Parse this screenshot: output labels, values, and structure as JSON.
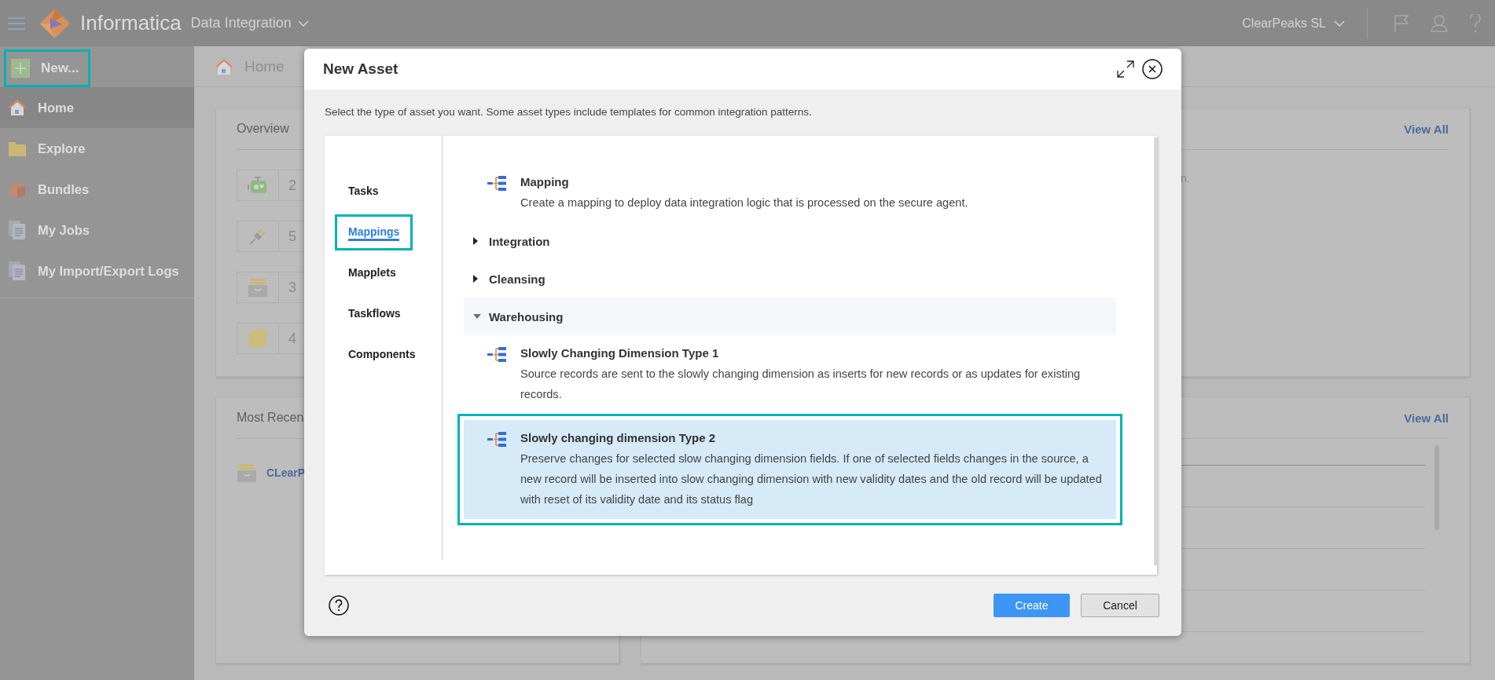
{
  "header": {
    "brand": "Informatica",
    "product": "Data Integration",
    "organization": "ClearPeaks SL"
  },
  "sidebar": {
    "new_button": {
      "label": "New...",
      "highlighted": true
    },
    "items": [
      {
        "label": "Home",
        "selected": true
      },
      {
        "label": "Explore",
        "selected": false
      },
      {
        "label": "Bundles",
        "selected": false
      },
      {
        "label": "My Jobs",
        "selected": false
      },
      {
        "label": "My Import/Export Logs",
        "selected": false
      }
    ]
  },
  "breadcrumb": "Home",
  "overview_card": {
    "title": "Overview",
    "counts": [
      "2",
      "5",
      "3",
      "4"
    ]
  },
  "activity_card": {
    "link": "View All",
    "text_fragment": "n."
  },
  "recent_card": {
    "title": "Most Recen",
    "items": [
      "CLearP"
    ]
  },
  "jobs_card": {
    "link": "View All"
  },
  "dialog": {
    "title": "New Asset",
    "instruction": "Select the type of asset you want. Some asset types include templates for common integration patterns.",
    "categories": [
      {
        "label": "Tasks",
        "selected": false,
        "highlighted": false
      },
      {
        "label": "Mappings",
        "selected": true,
        "highlighted": true
      },
      {
        "label": "Mapplets",
        "selected": false,
        "highlighted": false
      },
      {
        "label": "Taskflows",
        "selected": false,
        "highlighted": false
      },
      {
        "label": "Components",
        "selected": false,
        "highlighted": false
      }
    ],
    "entries": [
      {
        "kind": "asset",
        "title": "Mapping",
        "description": "Create a mapping to deploy data integration logic that is processed on the secure agent.",
        "selected": false,
        "highlighted": false
      },
      {
        "kind": "group",
        "label": "Integration",
        "expanded": false
      },
      {
        "kind": "group",
        "label": "Cleansing",
        "expanded": false
      },
      {
        "kind": "group",
        "label": "Warehousing",
        "expanded": true,
        "children": [
          {
            "kind": "asset",
            "title": "Slowly Changing Dimension Type 1",
            "description": "Source records are sent to the slowly changing dimension as inserts for new records or as updates for existing records.",
            "selected": false,
            "highlighted": false
          },
          {
            "kind": "asset",
            "title": "Slowly changing dimension Type 2",
            "description": "Preserve changes for selected slow changing dimension fields. If one of selected fields changes in the source, a new record will be inserted into slow changing dimension with new validity dates and the old record will be updated with reset of its validity date and its status flag",
            "selected": true,
            "highlighted": true
          }
        ]
      }
    ],
    "buttons": [
      {
        "label": "Create",
        "kind": "primary"
      },
      {
        "label": "Cancel",
        "kind": "secondary"
      }
    ]
  }
}
